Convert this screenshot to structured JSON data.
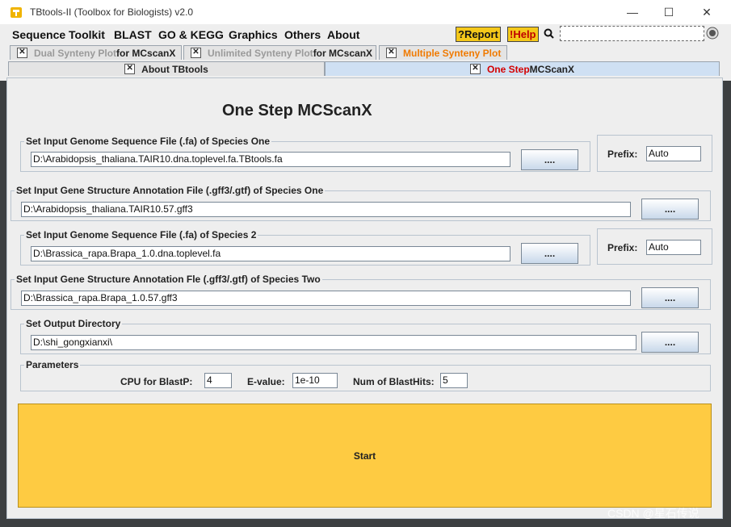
{
  "window": {
    "title": "TBtools-II (Toolbox for Biologists) v2.0",
    "minimize": "—",
    "maximize": "☐",
    "close": "✕"
  },
  "menu": [
    "Sequence Toolkit",
    "BLAST",
    "GO & KEGG",
    "Graphics",
    "Others",
    "About"
  ],
  "help_buttons": {
    "report": "?Report",
    "help": "!Help"
  },
  "tabs_row1": [
    {
      "prefix": "Dual Synteny Plot",
      "suffix": " for MCscanX"
    },
    {
      "prefix": "Unlimited Synteny Plot",
      "suffix": " for MCscanX"
    },
    {
      "prefix": "Multiple Synteny Plot",
      "suffix": ""
    }
  ],
  "tabs_row2": [
    {
      "prefix": "About TBtools",
      "suffix": ""
    },
    {
      "prefix": "One Step",
      "suffix": " MCScanX"
    }
  ],
  "heading": "One Step MCScanX",
  "sections": {
    "genome1": {
      "legend": "Set Input Genome Sequence File (.fa) of Species One",
      "value": "D:\\Arabidopsis_thaliana.TAIR10.dna.toplevel.fa.TBtools.fa",
      "button": "...."
    },
    "prefix1": {
      "label": "Prefix:",
      "value": "Auto"
    },
    "gff1": {
      "legend": "Set Input Gene Structure Annotation File (.gff3/.gtf) of Species One",
      "value": "D:\\Arabidopsis_thaliana.TAIR10.57.gff3",
      "button": "...."
    },
    "genome2": {
      "legend": "Set Input Genome Sequence File (.fa) of Species 2",
      "value": "D:\\Brassica_rapa.Brapa_1.0.dna.toplevel.fa",
      "button": "...."
    },
    "prefix2": {
      "label": "Prefix:",
      "value": "Auto"
    },
    "gff2": {
      "legend": "Set Input Gene Structure Annotation Fle (.gff3/.gtf) of Species Two",
      "value": "D:\\Brassica_rapa.Brapa_1.0.57.gff3",
      "button": "...."
    },
    "output": {
      "legend": "Set Output Directory",
      "value": "D:\\shi_gongxianxi\\",
      "button": "...."
    }
  },
  "parameters": {
    "legend": "Parameters",
    "cpu_label": "CPU for BlastP:",
    "cpu_value": "4",
    "evalue_label": "E-value:",
    "evalue_value": "1e-10",
    "hits_label": "Num of BlastHits:",
    "hits_value": "5"
  },
  "start_button": "Start",
  "watermark": "CSDN @星石传说"
}
